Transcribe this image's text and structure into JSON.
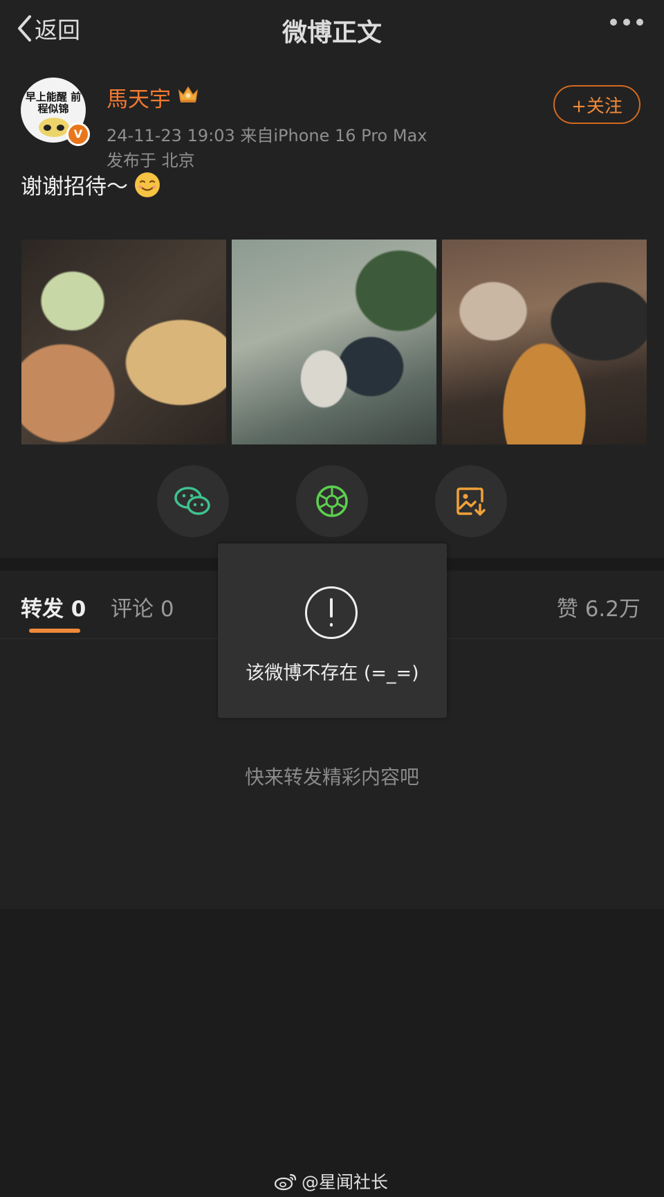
{
  "header": {
    "back_label": "返回",
    "title": "微博正文"
  },
  "post": {
    "avatar_text": "早上能醒 前程似锦",
    "verified_badge": "V",
    "username": "馬天宇",
    "meta_line": "24-11-23 19:03  来自iPhone 16 Pro Max",
    "location_line": "发布于 北京",
    "follow_label": "+关注",
    "text": "谢谢招待～",
    "photos": [
      "photo-1",
      "photo-2",
      "photo-3"
    ]
  },
  "share": {
    "icons": [
      "wechat-icon",
      "moments-icon",
      "save-image-icon"
    ]
  },
  "tabs": {
    "repost": "转发 0",
    "comment": "评论 0",
    "like": "赞 6.2万"
  },
  "empty_state": "快来转发精彩内容吧",
  "toast": {
    "message": "该微博不存在 (=_=)"
  },
  "watermark": {
    "text": "@星闻社长"
  },
  "colors": {
    "accent": "#f47a32",
    "background": "#1c1c1c",
    "panel": "#222222"
  }
}
